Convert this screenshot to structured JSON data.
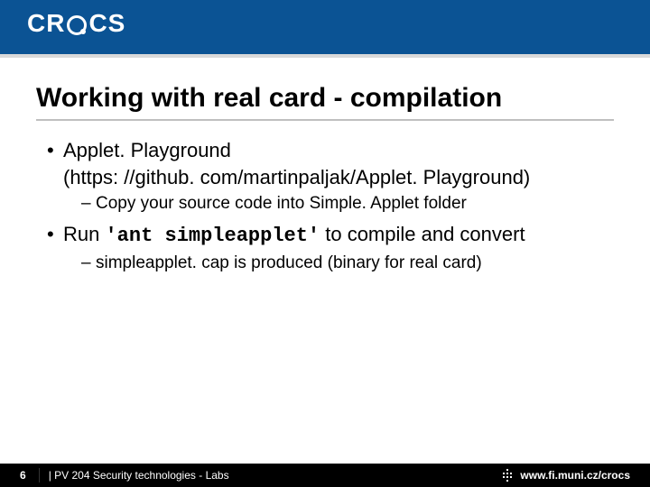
{
  "header": {
    "logo_text_left": "CR",
    "logo_text_right": "CS"
  },
  "title": "Working with real card - compilation",
  "bullets": [
    {
      "lines": [
        "Applet. Playground",
        "(https: //github. com/martinpaljak/Applet. Playground)"
      ],
      "sub": [
        "Copy your source code into Simple. Applet folder"
      ]
    },
    {
      "run_prefix": "Run ",
      "code": "'ant simpleapplet'",
      "run_suffix": " to compile and convert",
      "sub": [
        "simpleapplet. cap is produced (binary for real card)"
      ]
    }
  ],
  "footer": {
    "page_number": "6",
    "course": "| PV 204 Security technologies - Labs",
    "url": "www.fi.muni.cz/crocs"
  }
}
